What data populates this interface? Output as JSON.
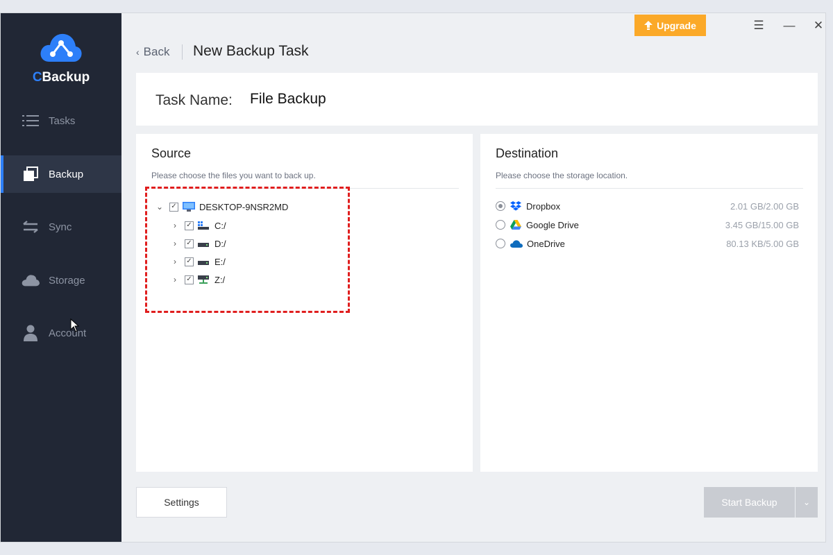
{
  "app": {
    "name_prefix": "C",
    "name_rest": "Backup"
  },
  "sidebar": {
    "items": [
      {
        "label": "Tasks",
        "icon": "list-icon"
      },
      {
        "label": "Backup",
        "icon": "backup-icon",
        "active": true
      },
      {
        "label": "Sync",
        "icon": "sync-arrows-icon"
      },
      {
        "label": "Storage",
        "icon": "cloud-icon"
      },
      {
        "label": "Account",
        "icon": "user-icon"
      }
    ]
  },
  "header": {
    "upgrade_label": "Upgrade",
    "back_label": "Back",
    "page_title": "New Backup Task"
  },
  "task": {
    "name_label": "Task Name:",
    "name_value": "File Backup"
  },
  "source": {
    "title": "Source",
    "subtitle": "Please choose the files you want to back up.",
    "root": "DESKTOP-9NSR2MD",
    "drives": [
      "C:/",
      "D:/",
      "E:/",
      "Z:/"
    ]
  },
  "destination": {
    "title": "Destination",
    "subtitle": "Please choose the storage location.",
    "options": [
      {
        "name": "Dropbox",
        "size": "2.01 GB/2.00 GB",
        "selected": true
      },
      {
        "name": "Google Drive",
        "size": "3.45 GB/15.00 GB",
        "selected": false
      },
      {
        "name": "OneDrive",
        "size": "80.13 KB/5.00 GB",
        "selected": false
      }
    ]
  },
  "footer": {
    "settings_label": "Settings",
    "start_label": "Start Backup"
  },
  "colors": {
    "accent": "#2d7ff9",
    "upgrade": "#fba928",
    "sidebar": "#212735",
    "highlight": "#e01e1e"
  }
}
